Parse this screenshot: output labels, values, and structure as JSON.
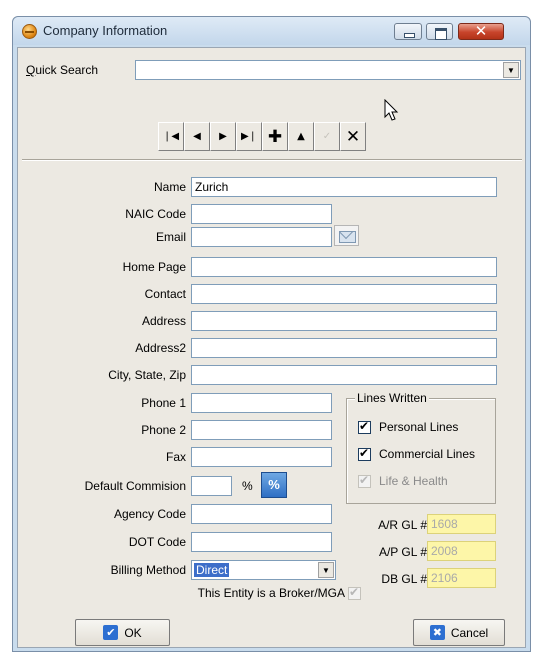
{
  "window": {
    "title": "Company Information",
    "controls": {
      "minimize": "minimize-icon",
      "maximize": "maximize-icon",
      "close": "✕"
    }
  },
  "quick_search": {
    "label_prefix": "Q",
    "label_rest": "uick Search",
    "value": ""
  },
  "toolbar": {
    "first": "❘◀",
    "prev": "◀",
    "next": "▶",
    "last": "▶❘",
    "add": "✚",
    "up": "▲",
    "edit": "✓",
    "delete": "✕"
  },
  "form": {
    "name": {
      "label": "Name",
      "value": "Zurich"
    },
    "naic_code": {
      "label": "NAIC Code",
      "value": ""
    },
    "email": {
      "label": "Email",
      "value": ""
    },
    "home_page": {
      "label": "Home Page",
      "value": ""
    },
    "contact": {
      "label": "Contact",
      "value": ""
    },
    "address": {
      "label": "Address",
      "value": ""
    },
    "address2": {
      "label": "Address2",
      "value": ""
    },
    "city_state_zip": {
      "label": "City, State, Zip",
      "value": ""
    },
    "phone1": {
      "label": "Phone 1",
      "value": ""
    },
    "phone2": {
      "label": "Phone 2",
      "value": ""
    },
    "fax": {
      "label": "Fax",
      "value": ""
    },
    "default_commission": {
      "label": "Default Commision",
      "value": "",
      "suffix": "%"
    },
    "agency_code": {
      "label": "Agency Code",
      "value": ""
    },
    "dot_code": {
      "label": "DOT Code",
      "value": ""
    },
    "billing_method": {
      "label": "Billing Method",
      "value": "Direct"
    },
    "broker_mga": {
      "label": "This Entity is a Broker/MGA",
      "checked": true,
      "enabled": false
    }
  },
  "lines_written": {
    "title": "Lines Written",
    "options": [
      {
        "label": "Personal Lines",
        "checked": true,
        "enabled": true
      },
      {
        "label": "Commercial Lines",
        "checked": true,
        "enabled": true
      },
      {
        "label": "Life & Health",
        "checked": true,
        "enabled": false
      }
    ]
  },
  "gl": {
    "ar": {
      "label": "A/R  GL #",
      "value": "1608"
    },
    "ap": {
      "label": "A/P  GL #",
      "value": "2008"
    },
    "db": {
      "label": "DB  GL #",
      "value": "2106"
    }
  },
  "buttons": {
    "ok": "OK",
    "cancel": "Cancel"
  },
  "colors": {
    "highlight_field": "#fdf6a8",
    "selection": "#3d6ec9",
    "title_bar": "#c3d7eb"
  }
}
